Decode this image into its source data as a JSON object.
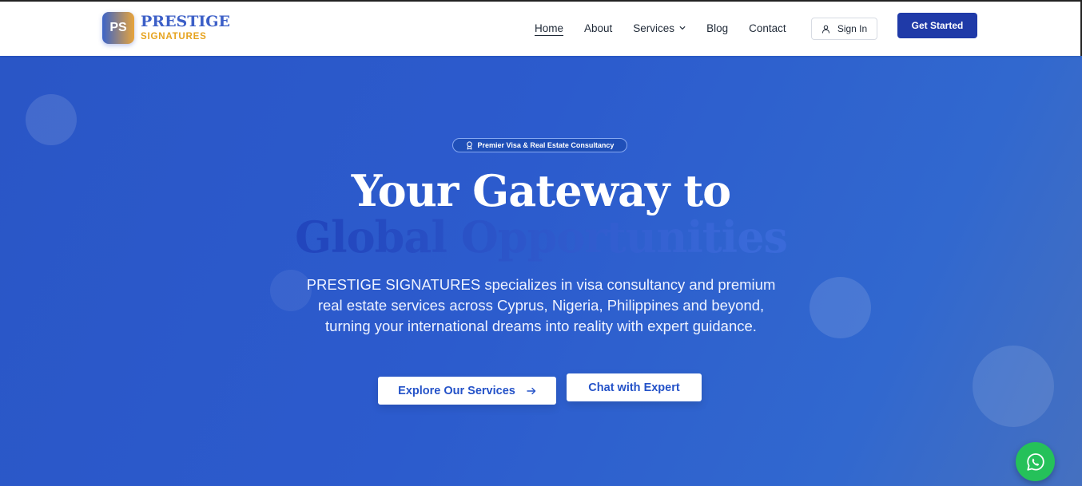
{
  "brand": {
    "initials": "PS",
    "name": "PRESTIGE",
    "sub": "SIGNATURES",
    "gradient_start": "#3b63c8",
    "gradient_end": "#e8a43b"
  },
  "nav": {
    "items": [
      {
        "label": "Home",
        "active": true
      },
      {
        "label": "About"
      },
      {
        "label": "Services",
        "icon": "chevron-down-icon"
      },
      {
        "label": "Blog"
      },
      {
        "label": "Contact"
      }
    ],
    "signin_label": "Sign In",
    "signin_icon": "user-icon",
    "cta_label": "Get Started",
    "cta_color": "#1f3aa8"
  },
  "hero": {
    "badge": "Premier Visa & Real Estate Consultancy",
    "badge_icon": "award-icon",
    "title_line1": "Your Gateway to",
    "title_line2": "Global Opportunities",
    "description": "PRESTIGE SIGNATURES specializes in visa consultancy and premium real estate services across Cyprus, Nigeria, Philippines and beyond, turning your international dreams into reality with expert guidance.",
    "primary_button": "Explore Our Services",
    "primary_button_icon": "arrow-right-icon",
    "secondary_button": "Chat with Expert",
    "background_color": "#2a56c6"
  },
  "whatsapp": {
    "icon": "whatsapp-icon",
    "color": "#25c15a"
  }
}
